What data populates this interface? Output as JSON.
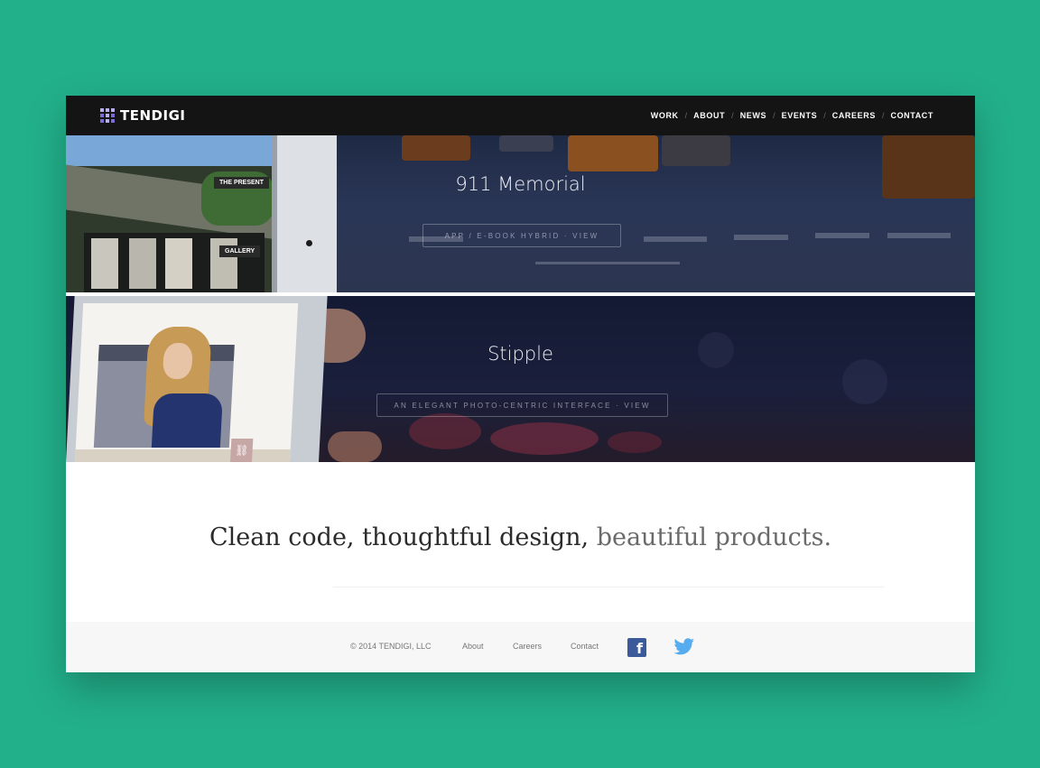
{
  "brand": {
    "name": "TENDIGI"
  },
  "nav": {
    "items": [
      "WORK",
      "ABOUT",
      "NEWS",
      "EVENTS",
      "CAREERS",
      "CONTACT"
    ],
    "separator": "/"
  },
  "projects": [
    {
      "title": "911 Memorial",
      "cta": "APP / E-BOOK HYBRID · VIEW",
      "tablet_labels": [
        "THE PRESENT",
        "GALLERY"
      ]
    },
    {
      "title": "Stipple",
      "cta": "AN ELEGANT PHOTO-CENTRIC INTERFACE · VIEW"
    }
  ],
  "tagline": {
    "part1": "Clean code, thoughtful design,",
    "part2": " beautiful products."
  },
  "footer": {
    "copyright": "© 2014 TENDIGI, LLC",
    "links": [
      "About",
      "Careers",
      "Contact"
    ],
    "social": [
      "facebook-icon",
      "twitter-icon"
    ]
  },
  "colors": {
    "background": "#22b08a",
    "header": "#141414",
    "facebook": "#3b5a9a",
    "twitter": "#55acee",
    "logo": "#7c6cd6"
  }
}
